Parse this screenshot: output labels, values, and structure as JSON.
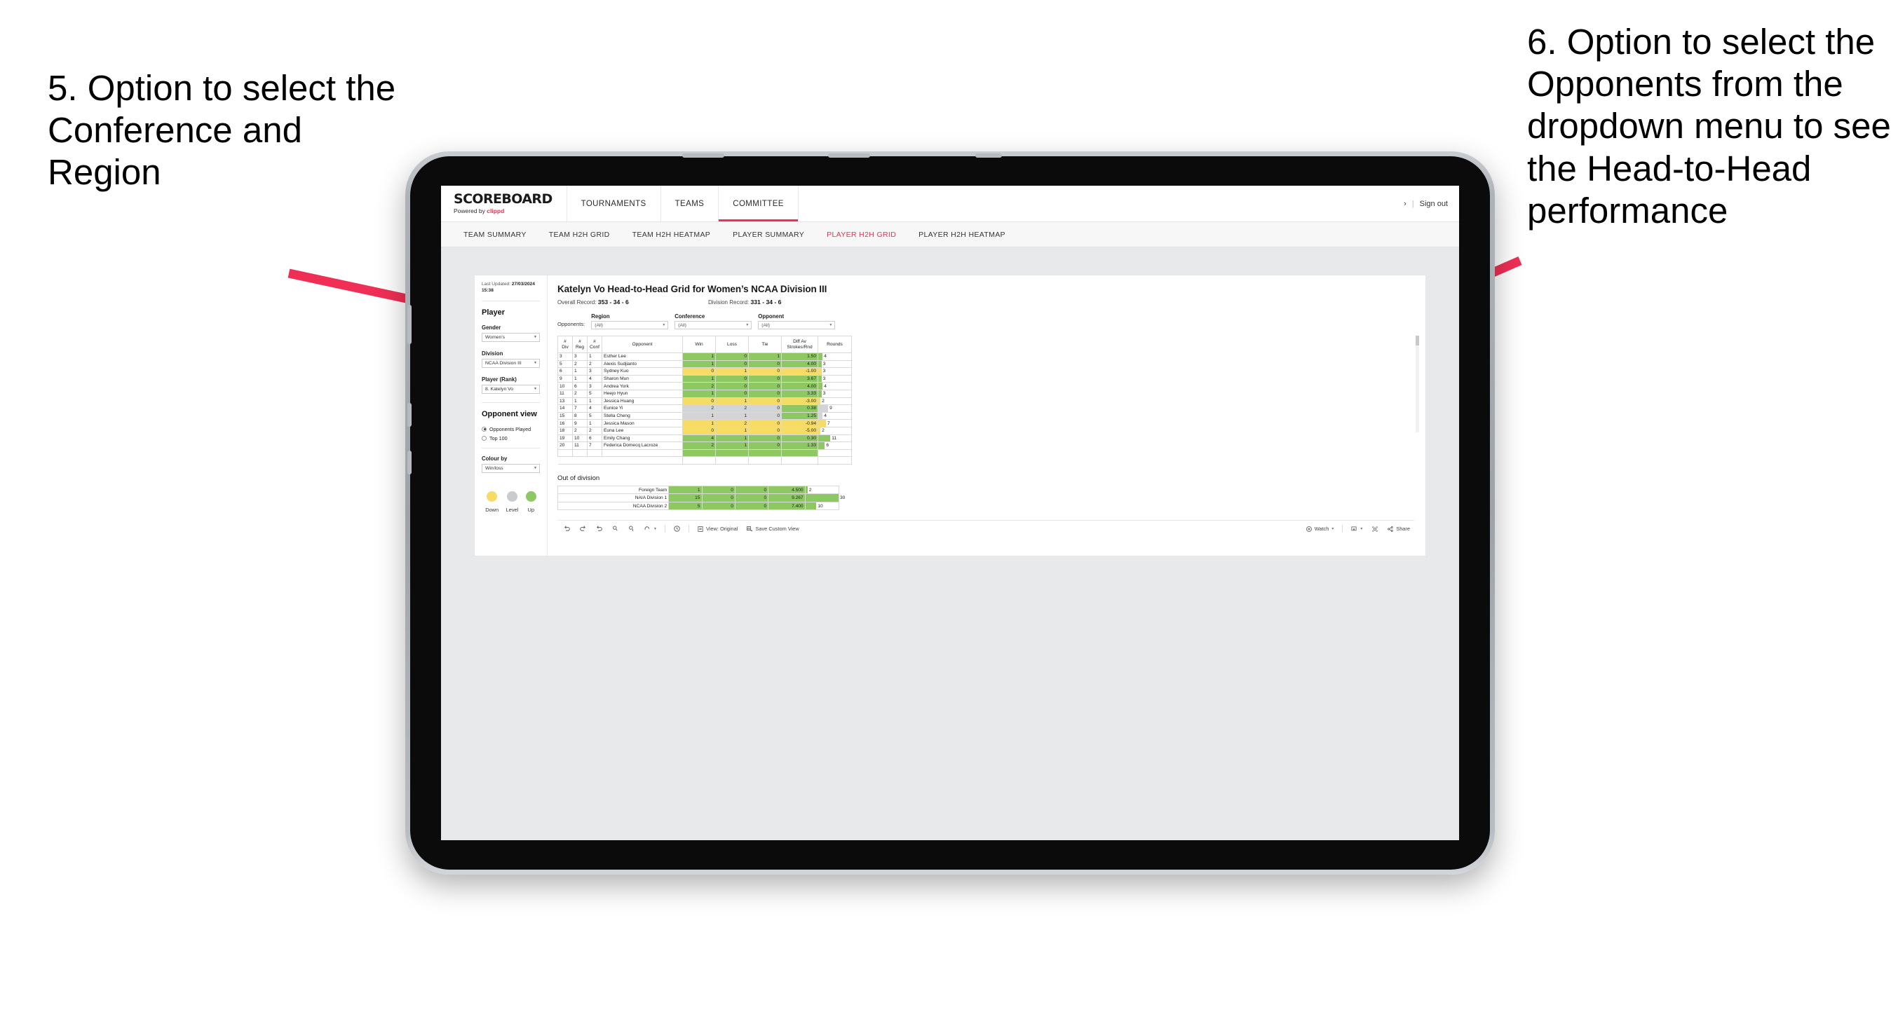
{
  "annotations": {
    "left": "5. Option to select the Conference and Region",
    "right": "6. Option to select the Opponents from the dropdown menu to see the Head-to-Head performance",
    "arrow_color": "#ef2f55"
  },
  "appbar": {
    "brand_title": "SCOREBOARD",
    "brand_powered_prefix": "Powered by ",
    "brand_powered_name": "clippd",
    "nav": [
      {
        "label": "TOURNAMENTS",
        "active": false
      },
      {
        "label": "TEAMS",
        "active": false
      },
      {
        "label": "COMMITTEE",
        "active": true
      }
    ],
    "chevron": "›",
    "separator": "|",
    "sign_out": "Sign out"
  },
  "subnav": [
    {
      "label": "TEAM SUMMARY",
      "active": false
    },
    {
      "label": "TEAM H2H GRID",
      "active": false
    },
    {
      "label": "TEAM H2H HEATMAP",
      "active": false
    },
    {
      "label": "PLAYER SUMMARY",
      "active": false
    },
    {
      "label": "PLAYER H2H GRID",
      "active": true
    },
    {
      "label": "PLAYER H2H HEATMAP",
      "active": false
    }
  ],
  "sidebar": {
    "last_updated_label": "Last Updated: ",
    "last_updated_value": "27/03/2024",
    "last_updated_time": "15:38",
    "section_player": "Player",
    "fields": [
      {
        "label": "Gender",
        "value": "Women’s"
      },
      {
        "label": "Division",
        "value": "NCAA Division III"
      },
      {
        "label": "Player (Rank)",
        "value": "8. Katelyn Vo"
      }
    ],
    "opponent_view_label": "Opponent view",
    "opponent_view_options": [
      {
        "label": "Opponents Played",
        "selected": true
      },
      {
        "label": "Top 100",
        "selected": false
      }
    ],
    "colour_by_label": "Colour by",
    "colour_by_value": "Win/loss",
    "legend": [
      {
        "label": "Down",
        "color": "#f6dc64"
      },
      {
        "label": "Level",
        "color": "#c9cbcd"
      },
      {
        "label": "Up",
        "color": "#8dc863"
      }
    ]
  },
  "view": {
    "title": "Katelyn Vo Head-to-Head Grid for Women’s NCAA Division III",
    "overall_record_label": "Overall Record: ",
    "overall_record_value": "353 - 34 - 6",
    "division_record_label": "Division Record: ",
    "division_record_value": "331 - 34 - 6",
    "opponents_label": "Opponents:",
    "filters": [
      {
        "label": "Region",
        "value": "(All)"
      },
      {
        "label": "Conference",
        "value": "(All)"
      },
      {
        "label": "Opponent",
        "value": "(All)"
      }
    ]
  },
  "table": {
    "headers": {
      "div": [
        "#",
        "Div"
      ],
      "reg": [
        "#",
        "Reg"
      ],
      "conf": [
        "#",
        "Conf"
      ],
      "opponent": "Opponent",
      "win": "Win",
      "loss": "Loss",
      "tie": "Tie",
      "diff": [
        "Diff Av",
        "Strokes/Rnd"
      ],
      "rounds": "Rounds"
    },
    "max_rounds": 30,
    "rows": [
      {
        "div": "3",
        "reg": "3",
        "conf": "1",
        "opponent": "Esther Lee",
        "win": "1",
        "loss": "0",
        "tie": "1",
        "diff": "1.50",
        "rounds": 4,
        "result": "up",
        "diff_sign": "up"
      },
      {
        "div": "5",
        "reg": "2",
        "conf": "2",
        "opponent": "Alexis Sudjianto",
        "win": "1",
        "loss": "0",
        "tie": "0",
        "diff": "4.00",
        "rounds": 3,
        "result": "up",
        "diff_sign": "up"
      },
      {
        "div": "6",
        "reg": "1",
        "conf": "3",
        "opponent": "Sydney Kuo",
        "win": "0",
        "loss": "1",
        "tie": "0",
        "diff": "-1.00",
        "rounds": 3,
        "result": "down",
        "diff_sign": "down"
      },
      {
        "div": "9",
        "reg": "1",
        "conf": "4",
        "opponent": "Sharon Mun",
        "win": "1",
        "loss": "0",
        "tie": "0",
        "diff": "3.67",
        "rounds": 3,
        "result": "up",
        "diff_sign": "up"
      },
      {
        "div": "10",
        "reg": "6",
        "conf": "3",
        "opponent": "Andrea York",
        "win": "2",
        "loss": "0",
        "tie": "0",
        "diff": "4.00",
        "rounds": 4,
        "result": "up",
        "diff_sign": "up"
      },
      {
        "div": "11",
        "reg": "2",
        "conf": "5",
        "opponent": "Heejo Hyun",
        "win": "1",
        "loss": "0",
        "tie": "0",
        "diff": "3.33",
        "rounds": 3,
        "result": "up",
        "diff_sign": "up"
      },
      {
        "div": "13",
        "reg": "1",
        "conf": "1",
        "opponent": "Jessica Huang",
        "win": "0",
        "loss": "1",
        "tie": "0",
        "diff": "-3.00",
        "rounds": 2,
        "result": "down",
        "diff_sign": "down"
      },
      {
        "div": "14",
        "reg": "7",
        "conf": "4",
        "opponent": "Eunice Yi",
        "win": "2",
        "loss": "2",
        "tie": "0",
        "diff": "0.38",
        "rounds": 9,
        "result": "level",
        "diff_sign": "up"
      },
      {
        "div": "15",
        "reg": "8",
        "conf": "5",
        "opponent": "Stella Cheng",
        "win": "1",
        "loss": "1",
        "tie": "0",
        "diff": "1.25",
        "rounds": 4,
        "result": "level",
        "diff_sign": "up"
      },
      {
        "div": "16",
        "reg": "9",
        "conf": "1",
        "opponent": "Jessica Mason",
        "win": "1",
        "loss": "2",
        "tie": "0",
        "diff": "-0.94",
        "rounds": 7,
        "result": "down",
        "diff_sign": "down"
      },
      {
        "div": "18",
        "reg": "2",
        "conf": "2",
        "opponent": "Euna Lee",
        "win": "0",
        "loss": "1",
        "tie": "0",
        "diff": "-5.00",
        "rounds": 2,
        "result": "down",
        "diff_sign": "down"
      },
      {
        "div": "19",
        "reg": "10",
        "conf": "6",
        "opponent": "Emily Chang",
        "win": "4",
        "loss": "1",
        "tie": "0",
        "diff": "0.30",
        "rounds": 11,
        "result": "up",
        "diff_sign": "up"
      },
      {
        "div": "20",
        "reg": "11",
        "conf": "7",
        "opponent": "Federica Domecq Lacroze",
        "win": "2",
        "loss": "1",
        "tie": "0",
        "diff": "1.33",
        "rounds": 6,
        "result": "up",
        "diff_sign": "up"
      }
    ]
  },
  "out_of_division": {
    "title": "Out of division",
    "max_rounds": 30,
    "rows": [
      {
        "name": "Foreign Team",
        "win": "1",
        "loss": "0",
        "tie": "0",
        "diff": "4.500",
        "rounds": 2,
        "result": "up"
      },
      {
        "name": "NAIA Division 1",
        "win": "15",
        "loss": "0",
        "tie": "0",
        "diff": "9.267",
        "rounds": 30,
        "result": "up"
      },
      {
        "name": "NCAA Division 2",
        "win": "5",
        "loss": "0",
        "tie": "0",
        "diff": "7.400",
        "rounds": 10,
        "result": "up"
      }
    ]
  },
  "toolbar": {
    "view_original": "View: Original",
    "save_custom_view": "Save Custom View",
    "watch": "Watch",
    "share": "Share",
    "caret": "▾"
  },
  "colors": {
    "up": "#8dc863",
    "down": "#f6dc64",
    "level": "#d2d4d6",
    "accent": "#ef2f55",
    "page_bg": "#e8e9eb"
  }
}
